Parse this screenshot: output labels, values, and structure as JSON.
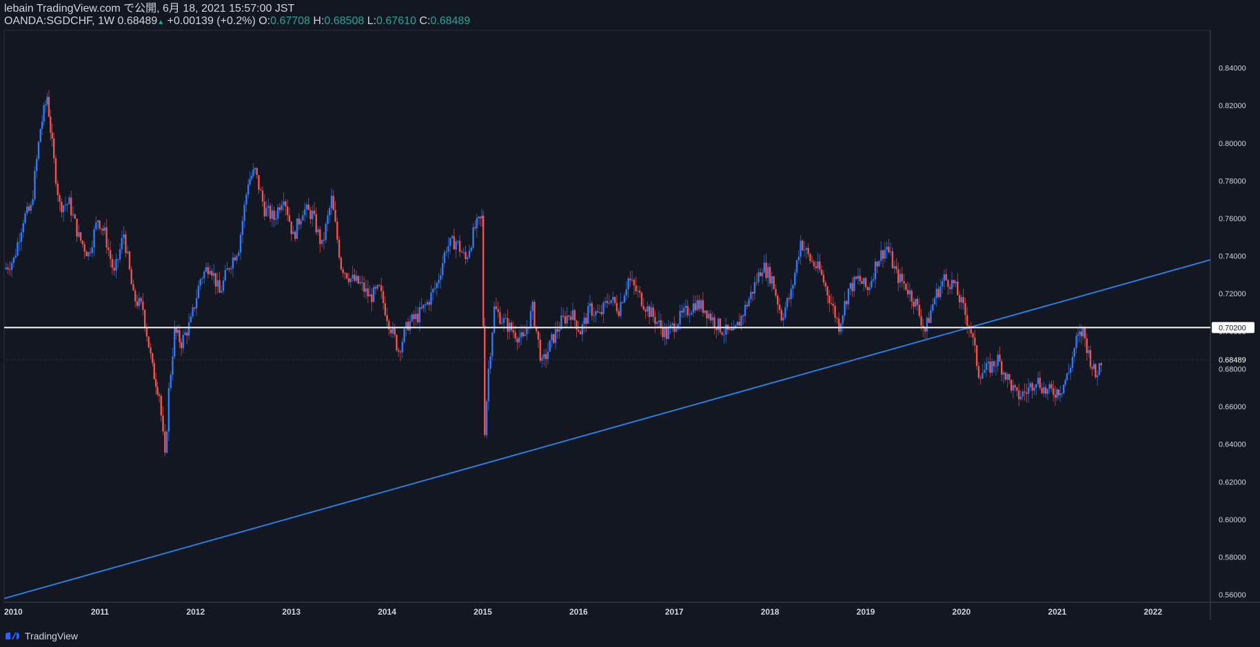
{
  "header": {
    "publisher": "lebain TradingView.com で公開, 6月 18, 2021 15:57:00 JST",
    "symbol": "OANDA:SGDCHF, 1W",
    "last": "0.68489",
    "change": "+0.00139 (+0.2%)",
    "o_label": "O:",
    "o_value": "0.67708",
    "h_label": "H:",
    "h_value": "0.68508",
    "l_label": "L:",
    "l_value": "0.67610",
    "c_label": "C:",
    "c_value": "0.68489"
  },
  "footer": {
    "brand": "TradingView"
  },
  "colors": {
    "background": "#131722",
    "up": "#3179f5",
    "down": "#ef5350",
    "trendline": "#2a7de1",
    "hline": "#ffffff",
    "axis_text": "#d1d4dc"
  },
  "chart_data": {
    "type": "candlestick",
    "x_ticks": [
      "2010",
      "2011",
      "2012",
      "2013",
      "2014",
      "2015",
      "2016",
      "2017",
      "2018",
      "2019",
      "2020",
      "2021",
      "2022"
    ],
    "y_ticks": [
      "0.84000",
      "0.82000",
      "0.80000",
      "0.78000",
      "0.76000",
      "0.74000",
      "0.72000",
      "0.70000",
      "0.68000",
      "0.66000",
      "0.64000",
      "0.62000",
      "0.60000",
      "0.58000",
      "0.56000"
    ],
    "ylim": [
      0.556,
      0.86
    ],
    "xlim": [
      2010.0,
      2022.6
    ],
    "horizontal_line": {
      "value": 0.702,
      "label": "0.70200"
    },
    "last_price_label": "0.68489",
    "trendline": {
      "points": [
        [
          2010.0,
          0.558
        ],
        [
          2022.6,
          0.738
        ]
      ]
    },
    "price_path": [
      [
        2010.0,
        0.733
      ],
      [
        2010.1,
        0.738
      ],
      [
        2010.2,
        0.76
      ],
      [
        2010.28,
        0.765
      ],
      [
        2010.38,
        0.808
      ],
      [
        2010.45,
        0.825
      ],
      [
        2010.52,
        0.79
      ],
      [
        2010.58,
        0.767
      ],
      [
        2010.68,
        0.768
      ],
      [
        2010.78,
        0.75
      ],
      [
        2010.88,
        0.741
      ],
      [
        2010.98,
        0.76
      ],
      [
        2011.05,
        0.752
      ],
      [
        2011.15,
        0.73
      ],
      [
        2011.25,
        0.752
      ],
      [
        2011.35,
        0.718
      ],
      [
        2011.45,
        0.712
      ],
      [
        2011.55,
        0.68
      ],
      [
        2011.62,
        0.667
      ],
      [
        2011.68,
        0.632
      ],
      [
        2011.72,
        0.668
      ],
      [
        2011.78,
        0.7
      ],
      [
        2011.85,
        0.694
      ],
      [
        2011.95,
        0.705
      ],
      [
        2012.05,
        0.728
      ],
      [
        2012.15,
        0.736
      ],
      [
        2012.25,
        0.72
      ],
      [
        2012.35,
        0.735
      ],
      [
        2012.45,
        0.745
      ],
      [
        2012.55,
        0.78
      ],
      [
        2012.62,
        0.785
      ],
      [
        2012.72,
        0.765
      ],
      [
        2012.82,
        0.76
      ],
      [
        2012.92,
        0.773
      ],
      [
        2013.02,
        0.75
      ],
      [
        2013.12,
        0.765
      ],
      [
        2013.22,
        0.762
      ],
      [
        2013.32,
        0.745
      ],
      [
        2013.42,
        0.77
      ],
      [
        2013.52,
        0.735
      ],
      [
        2013.62,
        0.728
      ],
      [
        2013.72,
        0.725
      ],
      [
        2013.82,
        0.718
      ],
      [
        2013.92,
        0.722
      ],
      [
        2014.02,
        0.705
      ],
      [
        2014.12,
        0.69
      ],
      [
        2014.22,
        0.704
      ],
      [
        2014.32,
        0.708
      ],
      [
        2014.42,
        0.715
      ],
      [
        2014.52,
        0.725
      ],
      [
        2014.62,
        0.745
      ],
      [
        2014.72,
        0.748
      ],
      [
        2014.82,
        0.738
      ],
      [
        2014.92,
        0.755
      ],
      [
        2014.99,
        0.76
      ],
      [
        2015.02,
        0.648
      ],
      [
        2015.06,
        0.68
      ],
      [
        2015.12,
        0.712
      ],
      [
        2015.22,
        0.705
      ],
      [
        2015.32,
        0.7
      ],
      [
        2015.42,
        0.695
      ],
      [
        2015.52,
        0.712
      ],
      [
        2015.62,
        0.682
      ],
      [
        2015.72,
        0.695
      ],
      [
        2015.82,
        0.705
      ],
      [
        2015.92,
        0.71
      ],
      [
        2016.02,
        0.7
      ],
      [
        2016.12,
        0.712
      ],
      [
        2016.22,
        0.708
      ],
      [
        2016.32,
        0.718
      ],
      [
        2016.42,
        0.712
      ],
      [
        2016.52,
        0.728
      ],
      [
        2016.62,
        0.72
      ],
      [
        2016.72,
        0.712
      ],
      [
        2016.82,
        0.705
      ],
      [
        2016.92,
        0.698
      ],
      [
        2017.02,
        0.705
      ],
      [
        2017.12,
        0.71
      ],
      [
        2017.22,
        0.715
      ],
      [
        2017.32,
        0.712
      ],
      [
        2017.42,
        0.705
      ],
      [
        2017.52,
        0.7
      ],
      [
        2017.62,
        0.698
      ],
      [
        2017.72,
        0.71
      ],
      [
        2017.82,
        0.722
      ],
      [
        2017.92,
        0.735
      ],
      [
        2018.02,
        0.728
      ],
      [
        2018.12,
        0.708
      ],
      [
        2018.22,
        0.72
      ],
      [
        2018.32,
        0.748
      ],
      [
        2018.42,
        0.738
      ],
      [
        2018.52,
        0.732
      ],
      [
        2018.62,
        0.718
      ],
      [
        2018.72,
        0.703
      ],
      [
        2018.82,
        0.722
      ],
      [
        2018.92,
        0.728
      ],
      [
        2019.02,
        0.722
      ],
      [
        2019.12,
        0.738
      ],
      [
        2019.22,
        0.745
      ],
      [
        2019.32,
        0.73
      ],
      [
        2019.42,
        0.724
      ],
      [
        2019.52,
        0.715
      ],
      [
        2019.62,
        0.7
      ],
      [
        2019.72,
        0.718
      ],
      [
        2019.82,
        0.728
      ],
      [
        2019.92,
        0.725
      ],
      [
        2020.02,
        0.712
      ],
      [
        2020.1,
        0.7
      ],
      [
        2020.18,
        0.678
      ],
      [
        2020.28,
        0.68
      ],
      [
        2020.38,
        0.685
      ],
      [
        2020.48,
        0.675
      ],
      [
        2020.58,
        0.665
      ],
      [
        2020.68,
        0.668
      ],
      [
        2020.78,
        0.675
      ],
      [
        2020.88,
        0.668
      ],
      [
        2020.98,
        0.668
      ],
      [
        2021.05,
        0.67
      ],
      [
        2021.12,
        0.678
      ],
      [
        2021.2,
        0.695
      ],
      [
        2021.27,
        0.7
      ],
      [
        2021.33,
        0.688
      ],
      [
        2021.4,
        0.676
      ],
      [
        2021.46,
        0.685
      ]
    ]
  }
}
